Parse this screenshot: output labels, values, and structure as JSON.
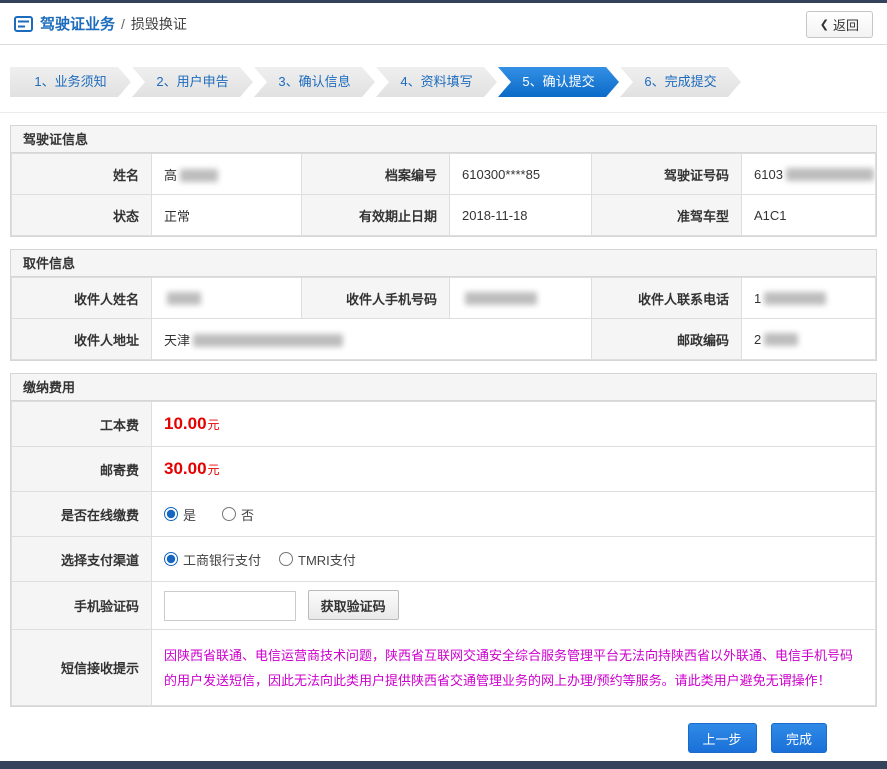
{
  "header": {
    "title": "驾驶证业务",
    "separator": "/",
    "subtitle": "损毁换证",
    "back_arrow": "❮",
    "back_label": "返回"
  },
  "steps": [
    {
      "label": "1、业务须知",
      "active": false
    },
    {
      "label": "2、用户申告",
      "active": false
    },
    {
      "label": "3、确认信息",
      "active": false
    },
    {
      "label": "4、资料填写",
      "active": false
    },
    {
      "label": "5、确认提交",
      "active": true
    },
    {
      "label": "6、完成提交",
      "active": false
    }
  ],
  "license_section": {
    "title": "驾驶证信息",
    "fields": {
      "name": {
        "label": "姓名",
        "value": "高"
      },
      "file_no": {
        "label": "档案编号",
        "value": "610300****85"
      },
      "license_no": {
        "label": "驾驶证号码",
        "value": "6103"
      },
      "status": {
        "label": "状态",
        "value": "正常"
      },
      "expiry": {
        "label": "有效期止日期",
        "value": "2018-11-18"
      },
      "vehicle_type": {
        "label": "准驾车型",
        "value": "A1C1"
      }
    }
  },
  "pickup_section": {
    "title": "取件信息",
    "fields": {
      "recipient_name": {
        "label": "收件人姓名",
        "value": ""
      },
      "recipient_mobile": {
        "label": "收件人手机号码",
        "value": ""
      },
      "recipient_phone": {
        "label": "收件人联系电话",
        "value": "1"
      },
      "recipient_address": {
        "label": "收件人地址",
        "value": "天津"
      },
      "postal_code": {
        "label": "邮政编码",
        "value": "2"
      }
    }
  },
  "fees_section": {
    "title": "缴纳费用",
    "production_fee": {
      "label": "工本费",
      "amount": "10.00",
      "unit": "元"
    },
    "postage_fee": {
      "label": "邮寄费",
      "amount": "30.00",
      "unit": "元"
    },
    "online_payment": {
      "label": "是否在线缴费",
      "options": [
        {
          "label": "是",
          "checked": true
        },
        {
          "label": "否",
          "checked": false
        }
      ]
    },
    "payment_channel": {
      "label": "选择支付渠道",
      "options": [
        {
          "label": "工商银行支付",
          "checked": true
        },
        {
          "label": "TMRI支付",
          "checked": false
        }
      ]
    },
    "verification": {
      "label": "手机验证码",
      "button_label": "获取验证码"
    },
    "sms_notice": {
      "label": "短信接收提示",
      "text": "因陕西省联通、电信运营商技术问题，陕西省互联网交通安全综合服务管理平台无法向持陕西省以外联通、电信手机号码的用户发送短信，因此无法向此类用户提供陕西省交通管理业务的网上办理/预约等服务。请此类用户避免无谓操作！"
    }
  },
  "footer": {
    "prev_label": "上一步",
    "finish_label": "完成"
  },
  "colors": {
    "accent_blue": "#1c6bbd",
    "active_step_blue": "#0b6ac8",
    "fee_red": "#e60000",
    "notice_magenta": "#cc00cc",
    "dark_bar": "#34425c"
  }
}
